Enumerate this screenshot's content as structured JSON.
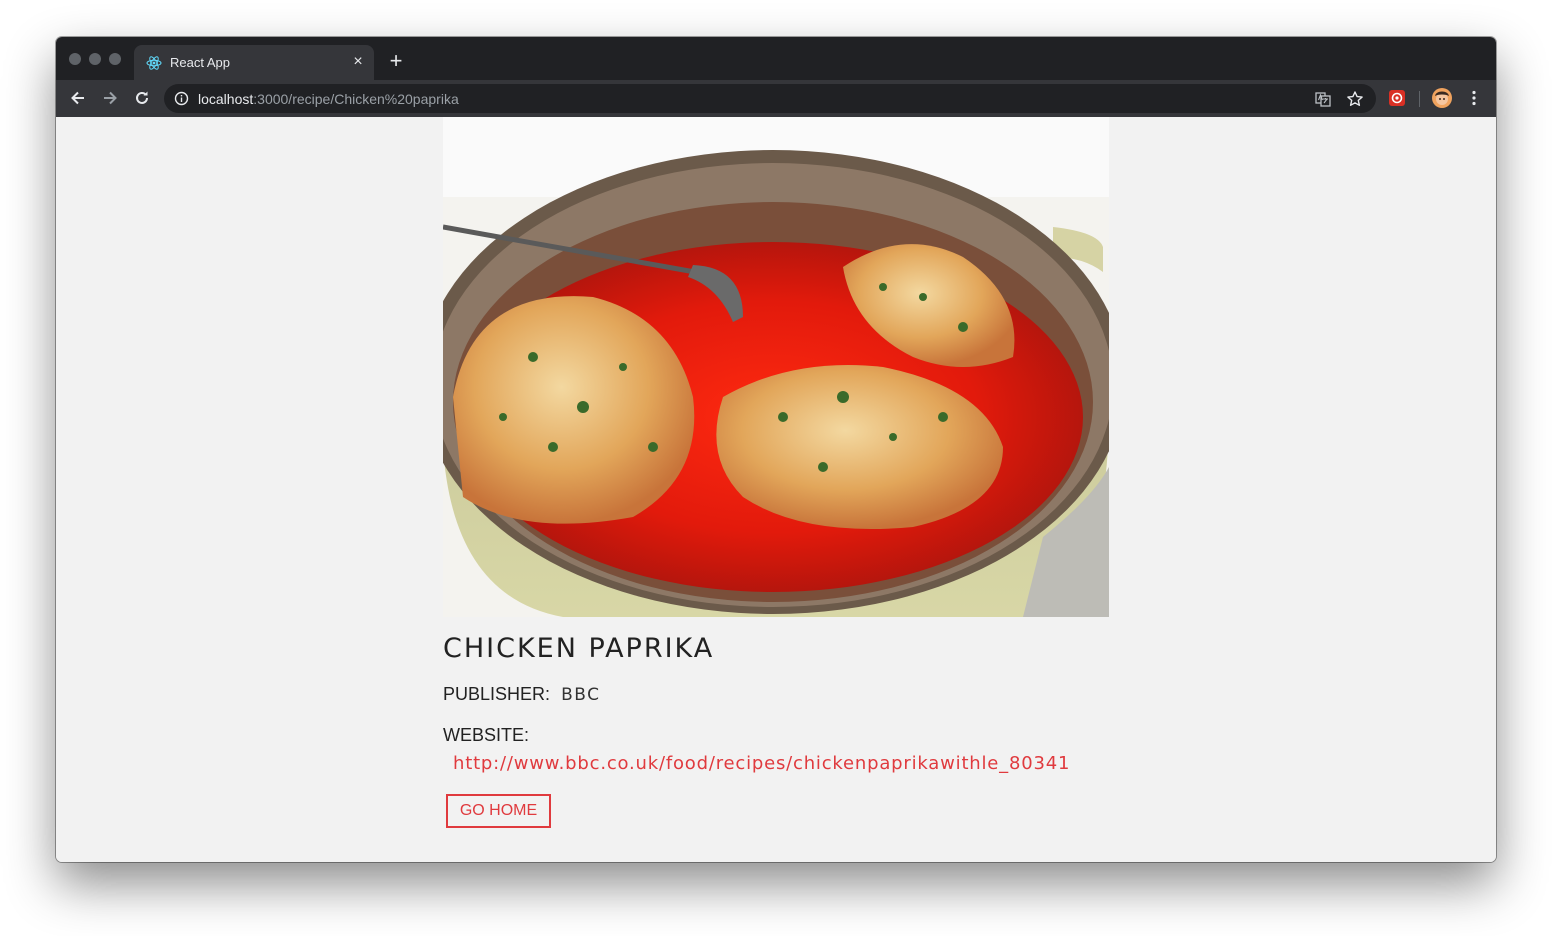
{
  "browser": {
    "tab": {
      "title": "React App",
      "favicon": "react-logo-icon",
      "close": "×"
    },
    "new_tab": "+",
    "url": {
      "host": "localhost",
      "path": ":3000/recipe/Chicken%20paprika"
    },
    "icons": [
      "back-arrow-icon",
      "forward-arrow-icon",
      "reload-icon",
      "info-icon",
      "translate-icon",
      "star-icon",
      "extension-icon",
      "avatar",
      "menu-icon"
    ]
  },
  "recipe": {
    "title": "CHICKEN PAPRIKA",
    "publisher_label": "PUBLISHER:",
    "publisher": "BBC",
    "website_label": "WEBSITE:",
    "website": "http://www.bbc.co.uk/food/recipes/chickenpaprikawithle_80341",
    "button_label": "GO HOME"
  },
  "colors": {
    "accent": "#e03a3e",
    "page_bg": "#f2f2f2",
    "chrome_dark": "#202124",
    "chrome_toolbar": "#35363a"
  }
}
